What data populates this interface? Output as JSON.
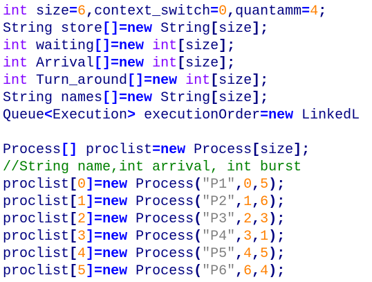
{
  "editor": {
    "background": "#ffffff",
    "colors": {
      "default": "#000080",
      "keyword": "#8000ff",
      "new": "#0000ff",
      "number": "#ff8000",
      "string": "#808080",
      "operator": "#0000ff",
      "comment": "#008000"
    },
    "lines": [
      [
        {
          "text": "int",
          "type": "keyword"
        },
        {
          "text": " size",
          "type": "default"
        },
        {
          "text": "=",
          "type": "operator"
        },
        {
          "text": "6",
          "type": "number"
        },
        {
          "text": ",",
          "type": "punct"
        },
        {
          "text": "context_switch",
          "type": "default"
        },
        {
          "text": "=",
          "type": "operator"
        },
        {
          "text": "0",
          "type": "number"
        },
        {
          "text": ",",
          "type": "punct"
        },
        {
          "text": "quantamm",
          "type": "default"
        },
        {
          "text": "=",
          "type": "operator"
        },
        {
          "text": "4",
          "type": "number"
        },
        {
          "text": ";",
          "type": "punct"
        }
      ],
      [
        {
          "text": "String store",
          "type": "default"
        },
        {
          "text": "[]=",
          "type": "operator"
        },
        {
          "text": "new",
          "type": "new"
        },
        {
          "text": " String",
          "type": "default"
        },
        {
          "text": "[",
          "type": "punct"
        },
        {
          "text": "size",
          "type": "default"
        },
        {
          "text": "];",
          "type": "punct"
        }
      ],
      [
        {
          "text": "int",
          "type": "keyword"
        },
        {
          "text": " waiting",
          "type": "default"
        },
        {
          "text": "[]=",
          "type": "operator"
        },
        {
          "text": "new",
          "type": "new"
        },
        {
          "text": " ",
          "type": "space"
        },
        {
          "text": "int",
          "type": "keyword"
        },
        {
          "text": "[",
          "type": "punct"
        },
        {
          "text": "size",
          "type": "default"
        },
        {
          "text": "];",
          "type": "punct"
        }
      ],
      [
        {
          "text": "int",
          "type": "keyword"
        },
        {
          "text": " Arrival",
          "type": "default"
        },
        {
          "text": "[]=",
          "type": "operator"
        },
        {
          "text": "new",
          "type": "new"
        },
        {
          "text": " ",
          "type": "space"
        },
        {
          "text": "int",
          "type": "keyword"
        },
        {
          "text": "[",
          "type": "punct"
        },
        {
          "text": "size",
          "type": "default"
        },
        {
          "text": "];",
          "type": "punct"
        }
      ],
      [
        {
          "text": "int",
          "type": "keyword"
        },
        {
          "text": " Turn_around",
          "type": "default"
        },
        {
          "text": "[]=",
          "type": "operator"
        },
        {
          "text": "new",
          "type": "new"
        },
        {
          "text": " ",
          "type": "space"
        },
        {
          "text": "int",
          "type": "keyword"
        },
        {
          "text": "[",
          "type": "punct"
        },
        {
          "text": "size",
          "type": "default"
        },
        {
          "text": "];",
          "type": "punct"
        }
      ],
      [
        {
          "text": "String names",
          "type": "default"
        },
        {
          "text": "[]=",
          "type": "operator"
        },
        {
          "text": "new",
          "type": "new"
        },
        {
          "text": " String",
          "type": "default"
        },
        {
          "text": "[",
          "type": "punct"
        },
        {
          "text": "size",
          "type": "default"
        },
        {
          "text": "];",
          "type": "punct"
        }
      ],
      [
        {
          "text": "Queue",
          "type": "default"
        },
        {
          "text": "<",
          "type": "operator"
        },
        {
          "text": "Execution",
          "type": "default"
        },
        {
          "text": ">",
          "type": "operator"
        },
        {
          "text": " executionOrder",
          "type": "default"
        },
        {
          "text": "=",
          "type": "operator"
        },
        {
          "text": "new",
          "type": "new"
        },
        {
          "text": " LinkedL",
          "type": "default"
        }
      ],
      [],
      [
        {
          "text": "Process",
          "type": "default"
        },
        {
          "text": "[]",
          "type": "operator"
        },
        {
          "text": " proclist",
          "type": "default"
        },
        {
          "text": "=",
          "type": "operator"
        },
        {
          "text": "new",
          "type": "new"
        },
        {
          "text": " Process",
          "type": "default"
        },
        {
          "text": "[",
          "type": "punct"
        },
        {
          "text": "size",
          "type": "default"
        },
        {
          "text": "];",
          "type": "punct"
        }
      ],
      [
        {
          "text": "//String name,int arrival, int burst",
          "type": "comment"
        }
      ],
      [
        {
          "text": "proclist",
          "type": "default"
        },
        {
          "text": "[",
          "type": "punct"
        },
        {
          "text": "0",
          "type": "number"
        },
        {
          "text": "]=",
          "type": "operator"
        },
        {
          "text": "new",
          "type": "new"
        },
        {
          "text": " Process",
          "type": "default"
        },
        {
          "text": "(",
          "type": "punct"
        },
        {
          "text": "\"P1\"",
          "type": "string"
        },
        {
          "text": ",",
          "type": "punct"
        },
        {
          "text": "0",
          "type": "number"
        },
        {
          "text": ",",
          "type": "punct"
        },
        {
          "text": "5",
          "type": "number"
        },
        {
          "text": ");",
          "type": "punct"
        }
      ],
      [
        {
          "text": "proclist",
          "type": "default"
        },
        {
          "text": "[",
          "type": "punct"
        },
        {
          "text": "1",
          "type": "number"
        },
        {
          "text": "]=",
          "type": "operator"
        },
        {
          "text": "new",
          "type": "new"
        },
        {
          "text": " Process",
          "type": "default"
        },
        {
          "text": "(",
          "type": "punct"
        },
        {
          "text": "\"P2\"",
          "type": "string"
        },
        {
          "text": ",",
          "type": "punct"
        },
        {
          "text": "1",
          "type": "number"
        },
        {
          "text": ",",
          "type": "punct"
        },
        {
          "text": "6",
          "type": "number"
        },
        {
          "text": ");",
          "type": "punct"
        }
      ],
      [
        {
          "text": "proclist",
          "type": "default"
        },
        {
          "text": "[",
          "type": "punct"
        },
        {
          "text": "2",
          "type": "number"
        },
        {
          "text": "]=",
          "type": "operator"
        },
        {
          "text": "new",
          "type": "new"
        },
        {
          "text": " Process",
          "type": "default"
        },
        {
          "text": "(",
          "type": "punct"
        },
        {
          "text": "\"P3\"",
          "type": "string"
        },
        {
          "text": ",",
          "type": "punct"
        },
        {
          "text": "2",
          "type": "number"
        },
        {
          "text": ",",
          "type": "punct"
        },
        {
          "text": "3",
          "type": "number"
        },
        {
          "text": ");",
          "type": "punct"
        }
      ],
      [
        {
          "text": "proclist",
          "type": "default"
        },
        {
          "text": "[",
          "type": "punct"
        },
        {
          "text": "3",
          "type": "number"
        },
        {
          "text": "]=",
          "type": "operator"
        },
        {
          "text": "new",
          "type": "new"
        },
        {
          "text": " Process",
          "type": "default"
        },
        {
          "text": "(",
          "type": "punct"
        },
        {
          "text": "\"P4\"",
          "type": "string"
        },
        {
          "text": ",",
          "type": "punct"
        },
        {
          "text": "3",
          "type": "number"
        },
        {
          "text": ",",
          "type": "punct"
        },
        {
          "text": "1",
          "type": "number"
        },
        {
          "text": ");",
          "type": "punct"
        }
      ],
      [
        {
          "text": "proclist",
          "type": "default"
        },
        {
          "text": "[",
          "type": "punct"
        },
        {
          "text": "4",
          "type": "number"
        },
        {
          "text": "]=",
          "type": "operator"
        },
        {
          "text": "new",
          "type": "new"
        },
        {
          "text": " Process",
          "type": "default"
        },
        {
          "text": "(",
          "type": "punct"
        },
        {
          "text": "\"P5\"",
          "type": "string"
        },
        {
          "text": ",",
          "type": "punct"
        },
        {
          "text": "4",
          "type": "number"
        },
        {
          "text": ",",
          "type": "punct"
        },
        {
          "text": "5",
          "type": "number"
        },
        {
          "text": ");",
          "type": "punct"
        }
      ],
      [
        {
          "text": "proclist",
          "type": "default"
        },
        {
          "text": "[",
          "type": "punct"
        },
        {
          "text": "5",
          "type": "number"
        },
        {
          "text": "]=",
          "type": "operator"
        },
        {
          "text": "new",
          "type": "new"
        },
        {
          "text": " Process",
          "type": "default"
        },
        {
          "text": "(",
          "type": "punct"
        },
        {
          "text": "\"P6\"",
          "type": "string"
        },
        {
          "text": ",",
          "type": "punct"
        },
        {
          "text": "6",
          "type": "number"
        },
        {
          "text": ",",
          "type": "punct"
        },
        {
          "text": "4",
          "type": "number"
        },
        {
          "text": ");",
          "type": "punct"
        }
      ]
    ]
  }
}
